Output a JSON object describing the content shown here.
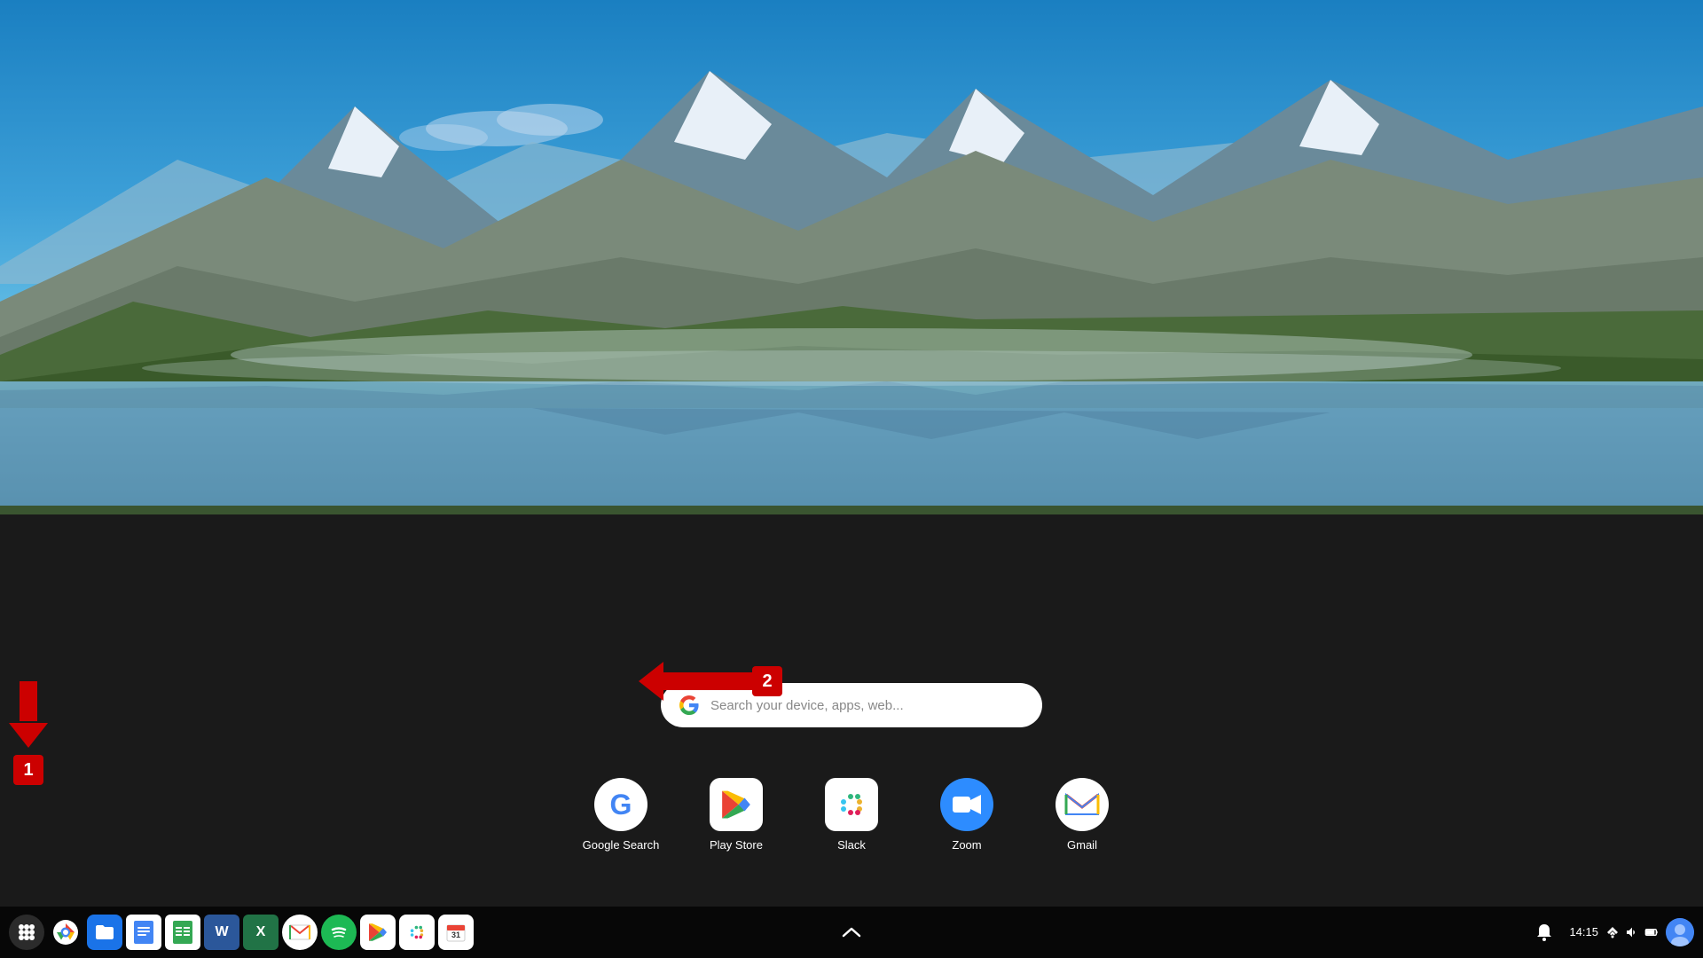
{
  "wallpaper": {
    "description": "Mountain lake landscape with snow-capped peaks and blue sky"
  },
  "search_bar": {
    "placeholder": "Search your device, apps, web...",
    "google_logo": "G"
  },
  "launcher_apps": [
    {
      "id": "google-search",
      "label": "Google Search",
      "icon_type": "google-g",
      "color": "#4285f4"
    },
    {
      "id": "play-store",
      "label": "Play Store",
      "icon_type": "playstore"
    },
    {
      "id": "slack",
      "label": "Slack",
      "icon_type": "slack"
    },
    {
      "id": "zoom",
      "label": "Zoom",
      "icon_type": "zoom"
    },
    {
      "id": "gmail",
      "label": "Gmail",
      "icon_type": "gmail"
    }
  ],
  "taskbar": {
    "apps": [
      {
        "id": "launcher",
        "type": "circle",
        "label": "Launcher"
      },
      {
        "id": "chrome",
        "type": "chrome",
        "label": "Chrome"
      },
      {
        "id": "files",
        "type": "files",
        "label": "Files"
      },
      {
        "id": "docs",
        "type": "docs",
        "label": "Google Docs"
      },
      {
        "id": "sheets",
        "type": "sheets",
        "label": "Google Sheets"
      },
      {
        "id": "word",
        "type": "word",
        "label": "Microsoft Word"
      },
      {
        "id": "excel",
        "type": "excel",
        "label": "Microsoft Excel"
      },
      {
        "id": "gmail",
        "type": "gmail",
        "label": "Gmail"
      },
      {
        "id": "spotify",
        "type": "spotify",
        "label": "Spotify"
      },
      {
        "id": "play",
        "type": "play",
        "label": "Play Store"
      },
      {
        "id": "slack",
        "type": "slack",
        "label": "Slack"
      },
      {
        "id": "calendar",
        "type": "calendar",
        "label": "Calendar"
      }
    ],
    "clock": "14:15",
    "chevron_label": "^"
  },
  "annotations": {
    "arrow1": {
      "number": "1",
      "direction": "down"
    },
    "arrow2": {
      "number": "2",
      "direction": "left"
    }
  }
}
